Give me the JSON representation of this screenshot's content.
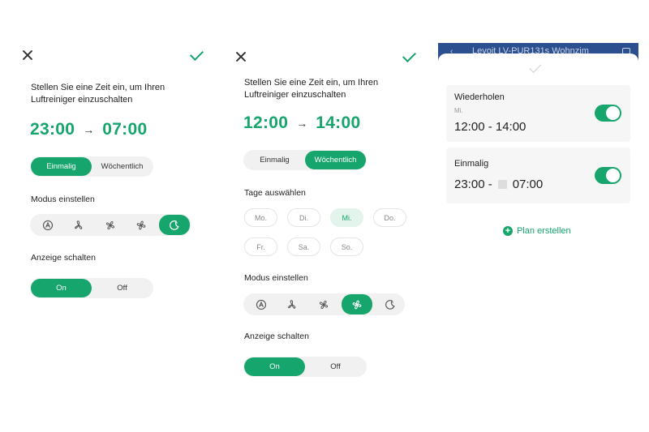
{
  "colors": {
    "accent": "#16a56c",
    "accent_light": "#e3f4ec",
    "track": "#f1f1f1",
    "header_blue": "#2c4f8f"
  },
  "icons": {
    "close": "close-icon",
    "confirm": "check-icon",
    "modes": [
      "auto-mode-icon",
      "fan-low-icon",
      "fan-mid-icon",
      "fan-high-icon",
      "sleep-mode-icon"
    ],
    "add": "plus-circle-icon",
    "calendar": "calendar-icon"
  },
  "panel1": {
    "prompt": "Stellen Sie eine Zeit ein, um Ihren Luftreiniger einzuschalten",
    "start_time": "23:00",
    "arrow": "→",
    "end_time": "07:00",
    "repeat_options": [
      "Einmalig",
      "Wöchentlich"
    ],
    "repeat_selected": "Einmalig",
    "mode_label": "Modus einstellen",
    "mode_selected": "sleep-mode-icon",
    "display_label": "Anzeige schalten",
    "display_options": [
      "On",
      "Off"
    ],
    "display_selected": "On"
  },
  "panel2": {
    "prompt": "Stellen Sie eine Zeit ein, um Ihren Luftreiniger einzuschalten",
    "start_time": "12:00",
    "arrow": "→",
    "end_time": "14:00",
    "repeat_options": [
      "Einmalig",
      "Wöchentlich"
    ],
    "repeat_selected": "Wöchentlich",
    "days_label": "Tage auswählen",
    "days": [
      "Mo.",
      "Di.",
      "Mi.",
      "Do.",
      "Fr.",
      "Sa.",
      "So."
    ],
    "days_selected": [
      "Mi."
    ],
    "mode_label": "Modus einstellen",
    "mode_selected": "fan-high-icon",
    "display_label": "Anzeige schalten",
    "display_options": [
      "On",
      "Off"
    ],
    "display_selected": "On"
  },
  "panel3": {
    "header_title": "Levoit LV-PUR131s Wohnzim",
    "schedules": [
      {
        "title": "Wiederholen",
        "subtitle": "Mi.",
        "time": "12:00 - 14:00",
        "enabled": true
      },
      {
        "title": "Einmalig",
        "start": "23:00 -",
        "end": "07:00",
        "enabled": true
      }
    ],
    "create_label": "Plan erstellen"
  }
}
